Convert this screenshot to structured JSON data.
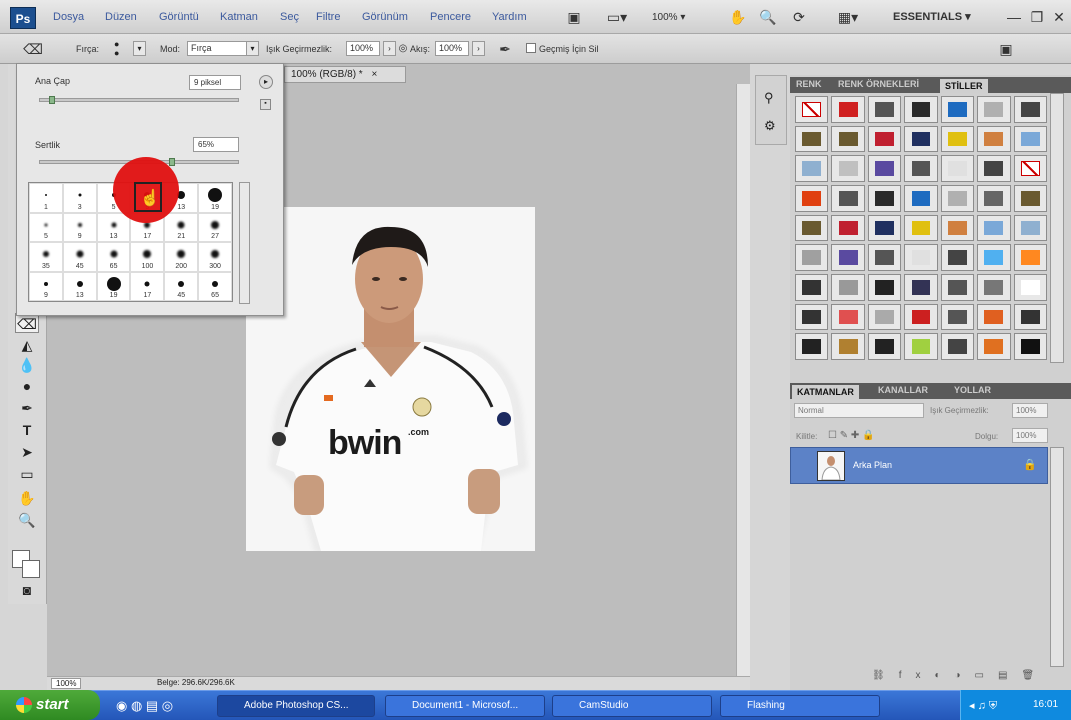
{
  "menubar": {
    "logo": "Ps",
    "items": [
      "Dosya",
      "Düzen",
      "Görüntü",
      "Katman",
      "Seç",
      "Filtre",
      "Görünüm",
      "Pencere",
      "Yardım"
    ],
    "zoom": "100%",
    "workspace": "ESSENTIALS"
  },
  "options": {
    "brush_label": "Fırça:",
    "mode_label": "Mod:",
    "mode_value": "Fırça",
    "opacity_label": "Işık Geçirmezlik:",
    "opacity_value": "100%",
    "flow_label": "Akış:",
    "flow_value": "100%",
    "erase_history": "Geçmiş İçin Sil"
  },
  "brush_picker": {
    "size_label": "Ana Çap",
    "size_value": "9 piksel",
    "hardness_label": "Sertlik",
    "hardness_value": "65%",
    "size_fraction": 0.05,
    "hardness_fraction": 0.65,
    "brushes": [
      {
        "label": "1",
        "d": 2
      },
      {
        "label": "3",
        "d": 3
      },
      {
        "label": "5",
        "d": 4
      },
      {
        "label": "9",
        "d": 6
      },
      {
        "label": "13",
        "d": 8
      },
      {
        "label": "19",
        "d": 14
      },
      {
        "label": "5",
        "d": 3
      },
      {
        "label": "9",
        "d": 4
      },
      {
        "label": "13",
        "d": 5
      },
      {
        "label": "17",
        "d": 6
      },
      {
        "label": "21",
        "d": 7
      },
      {
        "label": "27",
        "d": 8
      },
      {
        "label": "35",
        "d": 6
      },
      {
        "label": "45",
        "d": 7
      },
      {
        "label": "65",
        "d": 7
      },
      {
        "label": "100",
        "d": 8
      },
      {
        "label": "200",
        "d": 8
      },
      {
        "label": "300",
        "d": 8
      },
      {
        "label": "9",
        "d": 4
      },
      {
        "label": "13",
        "d": 6
      },
      {
        "label": "19",
        "d": 14
      },
      {
        "label": "17",
        "d": 5
      },
      {
        "label": "45",
        "d": 6
      },
      {
        "label": "65",
        "d": 6
      }
    ]
  },
  "document": {
    "tab_title": "100% (RGB/8) *",
    "close": "×",
    "jersey_text": "bwin",
    "jersey_small": ".com"
  },
  "status": {
    "zoom": "100%",
    "doc_size": "Belge: 296.6K/296.6K"
  },
  "panels": {
    "top_tabs": [
      "RENK",
      "RENK ÖRNEKLERİ",
      "STİLLER"
    ],
    "layer_tabs": [
      "KATMANLAR",
      "KANALLAR",
      "YOLLAR"
    ],
    "blend_mode": "Normal",
    "opacity_label": "Işık Geçirmezlik:",
    "opacity_value": "100%",
    "lock_label": "Kilitle:",
    "fill_label": "Dolgu:",
    "fill_value": "100%",
    "layer_name": "Arka Plan",
    "style_colors": [
      "#ffffff",
      "#d02020",
      "#555555",
      "#2a2a2a",
      "#1e6bc0",
      "#b0b0b0",
      "#444444",
      "#6a5a30",
      "#6a5a30",
      "#c02030",
      "#203060",
      "#e0c010",
      "#d08040",
      "#7aa8d8",
      "#8fb0d0",
      "#c0c0c0",
      "#5a4aa0",
      "#555555",
      "#e0e0e0",
      "#444444",
      "#ffffff",
      "#e04010",
      "#555555",
      "#2a2a2a",
      "#1e6bc0",
      "#b0b0b0",
      "#666666",
      "#6a5a30",
      "#6a5a30",
      "#c02030",
      "#203060",
      "#e0c010",
      "#d08040",
      "#7aa8d8",
      "#8fb0d0",
      "#a0a0a0",
      "#5a4aa0",
      "#555555",
      "#e0e0e0",
      "#444444",
      "#50b0f0",
      "#ff8820",
      "#333333",
      "#999999",
      "#222222",
      "#333355",
      "#555555",
      "#777777",
      "#ffffff",
      "#333333",
      "#e05050",
      "#aaaaaa",
      "#cc2020",
      "#555555",
      "#e06020",
      "#333333",
      "#222222",
      "#b08030",
      "#222222",
      "#a0d040",
      "#444444",
      "#e07020",
      "#111111"
    ]
  },
  "taskbar": {
    "start": "start",
    "tasks": [
      "Adobe Photoshop CS...",
      "Document1 - Microsof...",
      "CamStudio",
      "Flashing"
    ],
    "time": "16:01"
  }
}
